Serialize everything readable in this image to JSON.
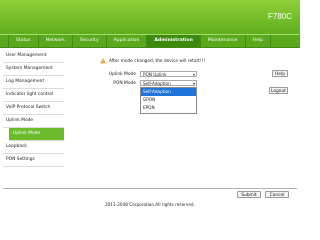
{
  "header": {
    "model": "F780C"
  },
  "topnav": {
    "tabs": [
      {
        "label": "Status"
      },
      {
        "label": "Network"
      },
      {
        "label": "Security"
      },
      {
        "label": "Application"
      },
      {
        "label": "Administration"
      },
      {
        "label": "Maintenance"
      },
      {
        "label": "Help"
      }
    ],
    "active_tab": "Administration"
  },
  "sidebar": {
    "items": [
      {
        "label": "User Management"
      },
      {
        "label": "System Management"
      },
      {
        "label": "Log Management"
      },
      {
        "label": "Indicator light control"
      },
      {
        "label": "VoIP Protocol Switch"
      },
      {
        "label": "Uplink Mode"
      },
      {
        "label": "Uplink Mode",
        "sub": true,
        "active": true
      },
      {
        "label": "Loopback"
      },
      {
        "label": "PON Settings"
      }
    ]
  },
  "content": {
    "notice": "After mode changed, the device will retart!!!",
    "uplink_mode": {
      "label": "Uplink Mode",
      "value": "PON Uplink"
    },
    "pon_mode": {
      "label": "PON Mode",
      "value": "Self-Adaption",
      "options": [
        "Self-Adaption",
        "GPON",
        "EPON"
      ],
      "highlighted_option": "Self-Adaption"
    }
  },
  "buttons": {
    "help": "Help",
    "logout": "Logout",
    "submit": "Submit",
    "cancel": "Cancel"
  },
  "footer": {
    "copyright": "2011-2048 Corporation.All rights reserved."
  },
  "colors": {
    "brand_green": "#5aa81b",
    "active_tab": "#3c8b10",
    "selected_option": "#1e74d8"
  }
}
